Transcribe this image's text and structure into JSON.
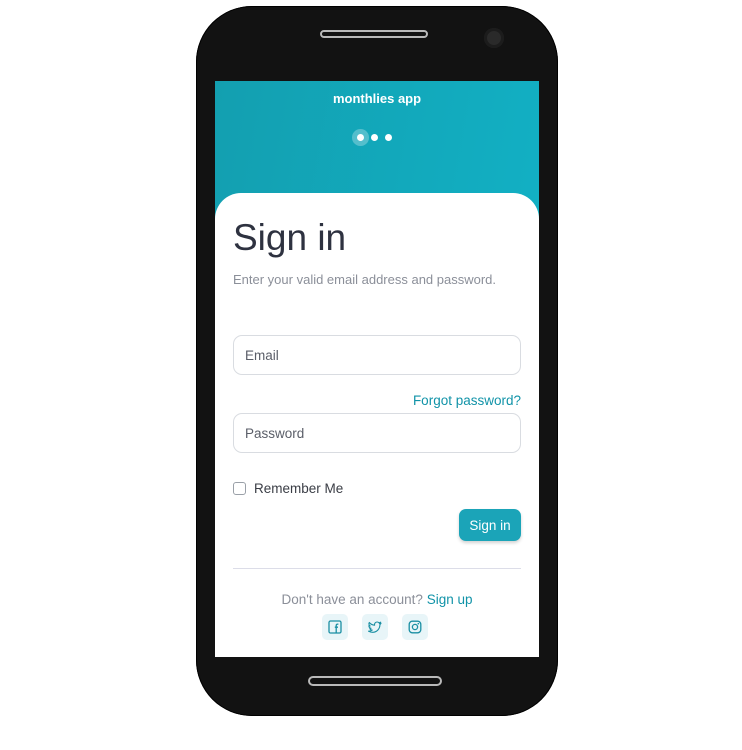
{
  "onboarding": {
    "app_name_line": "monthlies app",
    "carousel": {
      "slide_count": 3,
      "active_index": 0
    }
  },
  "signin": {
    "title": "Sign in",
    "subtitle": "Enter your valid email address and password.",
    "email": {
      "placeholder": "Email",
      "value": ""
    },
    "forgot_password": "Forgot password?",
    "password": {
      "placeholder": "Password",
      "value": ""
    },
    "remember_me": {
      "label": "Remember Me",
      "checked": false
    },
    "submit_label": "Sign in",
    "signup_prompt": "Don't have an account?",
    "signup_link": "Sign up",
    "social_icons": [
      "facebook-icon",
      "twitter-icon",
      "instagram-icon"
    ]
  },
  "colors": {
    "accent": "#1ba4b8",
    "hero_gradient_start": "#139fb0",
    "hero_gradient_end": "#12b0c4",
    "title_text": "#2e3240",
    "muted_text": "#8b8f99"
  }
}
